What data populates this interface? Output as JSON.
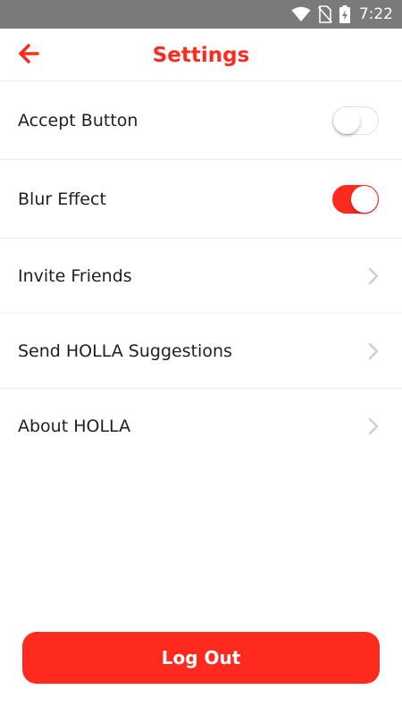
{
  "status_bar": {
    "time": "7:22",
    "icons": [
      "wifi-icon",
      "no-sim-icon",
      "battery-charging-icon"
    ]
  },
  "header": {
    "title": "Settings",
    "back_icon": "arrow-left-icon"
  },
  "settings": {
    "items": [
      {
        "label": "Accept Button",
        "type": "toggle",
        "on": false
      },
      {
        "label": "Blur Effect",
        "type": "toggle",
        "on": true
      },
      {
        "label": "Invite Friends",
        "type": "link",
        "icon": "chevron-right-icon"
      },
      {
        "label": "Send HOLLA Suggestions",
        "type": "link",
        "icon": "chevron-right-icon"
      },
      {
        "label": "About HOLLA",
        "type": "link",
        "icon": "chevron-right-icon"
      }
    ]
  },
  "footer": {
    "logout_label": "Log Out"
  },
  "colors": {
    "accent": "#ff2a1e",
    "status_bar": "#7a7a7a",
    "text": "#1f1f1f",
    "divider": "#eeeeee",
    "chevron": "#cfcfcf"
  }
}
